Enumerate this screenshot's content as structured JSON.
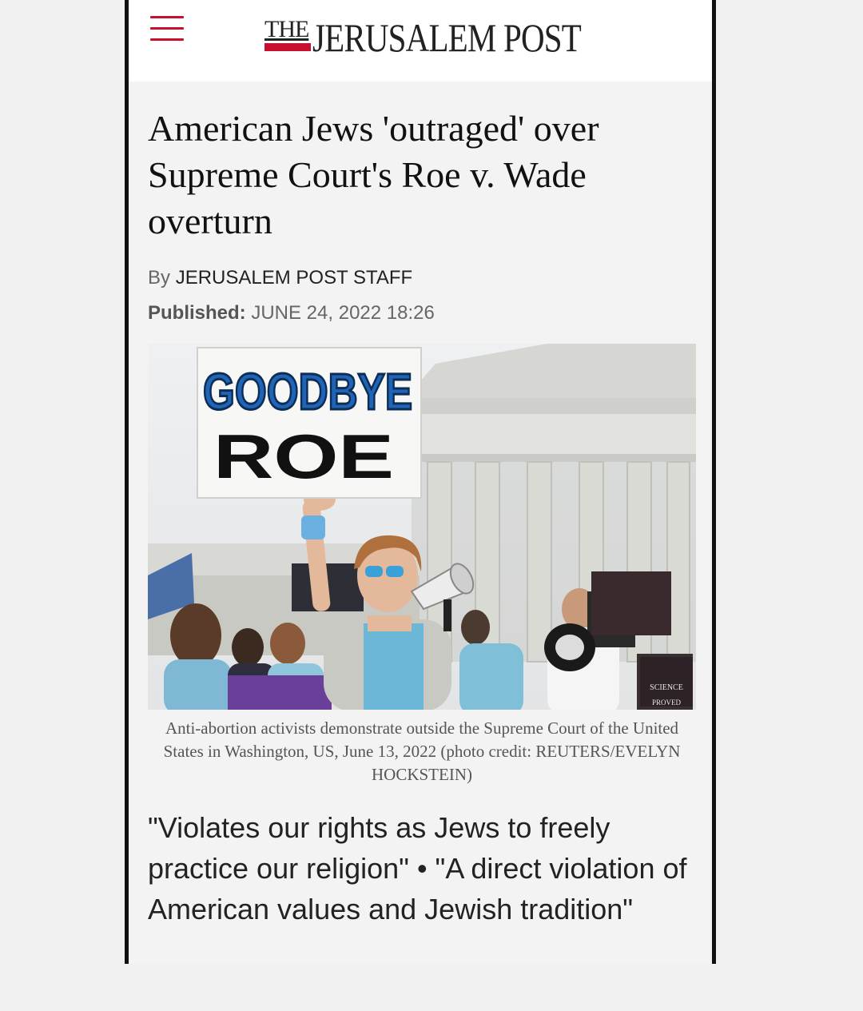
{
  "brand": {
    "logo_the": "THE",
    "logo_main": "JERUSALEM POST",
    "accent": "#c8102e"
  },
  "article": {
    "headline": "American Jews 'outraged' over Supreme Court's Roe v. Wade overturn",
    "byline_prefix": "By",
    "byline_author": "JERUSALEM POST STAFF",
    "published_label": "Published:",
    "published_value": "JUNE 24, 2022 18:26",
    "photo": {
      "sign_line1": "GOODBYE",
      "sign_line2": "ROE",
      "sign_science": "SCIENCE",
      "sign_proved": "PROVED"
    },
    "caption": "Anti-abortion activists demonstrate outside the Supreme Court of the United States in Washington, US, June 13, 2022 (photo credit: REUTERS/EVELYN HOCKSTEIN)",
    "subhead": "\"Violates our rights as Jews to freely practice our religion\" • \"A direct violation of American values and Jewish tradition\""
  },
  "icons": {
    "menu": "hamburger-menu-icon"
  }
}
